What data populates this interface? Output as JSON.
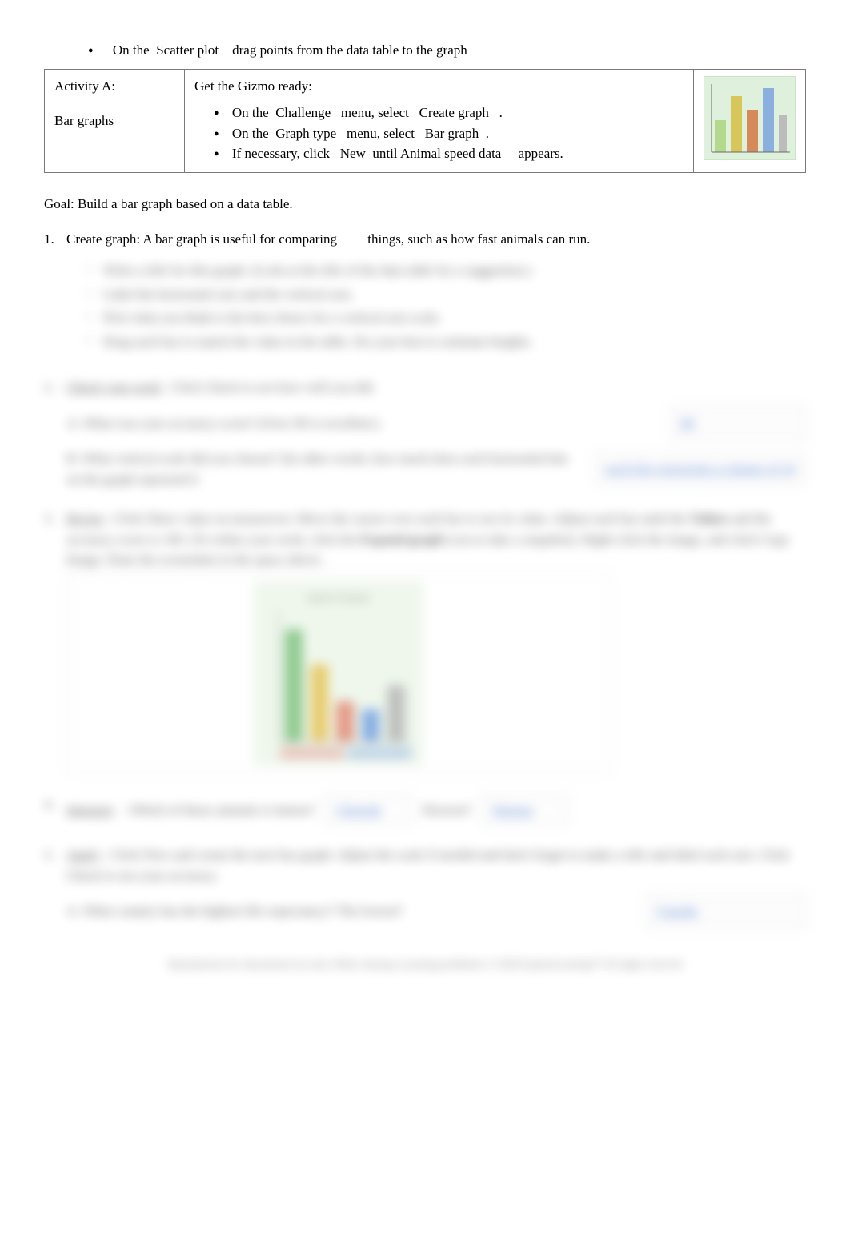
{
  "top_bullet_prefix": "On the",
  "top_bullet_mid": "Scatter plot",
  "top_bullet_suffix": "drag points from the data table to the graph",
  "activity": {
    "title": "Activity A:",
    "subtitle": "Bar graphs",
    "ready_heading": "Get the Gizmo ready:",
    "r1a": "On the",
    "r1b": "Challenge",
    "r1c": "menu, select",
    "r1d": "Create graph",
    "r1e": ".",
    "r2a": "On the",
    "r2b": "Graph type",
    "r2c": "menu, select",
    "r2d": "Bar graph",
    "r2e": ".",
    "r3a": "If necessary, click",
    "r3b": "New",
    "r3c": "until Animal speed data",
    "r3d": "appears."
  },
  "goal": "Goal: Build a bar graph based on a data table.",
  "q1": {
    "num": "1.",
    "lead": "Create graph: A bar graph is useful for comparing",
    "tail": "things, such as how fast animals can run.",
    "s1": "Write a title for this graph. (Look at the title of the data table for a suggestion.)",
    "s2": "Label the horizontal axis and the vertical axis.",
    "s3": "Pick what you think is the best choice for a vertical axis scale.",
    "s4": "Drag each bar to match the value in the table. Do your best to estimate heights."
  },
  "q2": {
    "num": "2.",
    "title": "Check your work",
    "body": ": Click Check to see how well you did.",
    "a_prompt": "A. What was your accuracy score? (Over 90 is excellent.)",
    "a_ans": "98",
    "b_prompt": "B. What vertical scale did you choose? (In other words, how much does each horizontal line on the graph represent?)",
    "b_ans": "each line represents a change of 10"
  },
  "q3": {
    "num": "3.",
    "title": "Revise",
    "lead": ": Click Show value on mouseover. Move the cursor over each bar to see its value. Adjust each bar until the",
    "word_values": "Values",
    "mid": "and the accuracy score is 100. (To refine your work, click the",
    "word_expand": "Expand graph",
    "tail1": "icon to take a snapshot). Right-click the image, and click Copy Image. Paste the screenshot in the space above.",
    "chart_title": "Speed of Animals"
  },
  "q4": {
    "num": "4.",
    "title": "Interpret",
    "body": ": Which of these animals is fastest?",
    "ans1": "Cheetah",
    "mid": "Slowest?",
    "ans2": "Human"
  },
  "q5": {
    "num": "5.",
    "title": "Apply",
    "body1": ": Click New and create the next bar graph. Adjust the scale if needed and don't forget to make a title and label each axis. Click Check to see your accuracy.",
    "sub": "A. What country has the highest life expectancy? The lowest?",
    "ans": "Canada"
  },
  "footer": "Reproduction for educational use only. Public sharing or posting prohibited. © 2020 ExploreLearning™ All rights reserved",
  "chart_data": {
    "type": "bar",
    "title": "Speed of Animals",
    "categories": [
      "Cheetah",
      "Horse",
      "Elephant",
      "Human",
      "Rabbit"
    ],
    "values": [
      70,
      48,
      25,
      20,
      35
    ],
    "colors": [
      "#3aa03a",
      "#d9a400",
      "#d24a2a",
      "#2a6ed2",
      "#8e8e8e"
    ],
    "ylim": [
      0,
      80
    ]
  }
}
